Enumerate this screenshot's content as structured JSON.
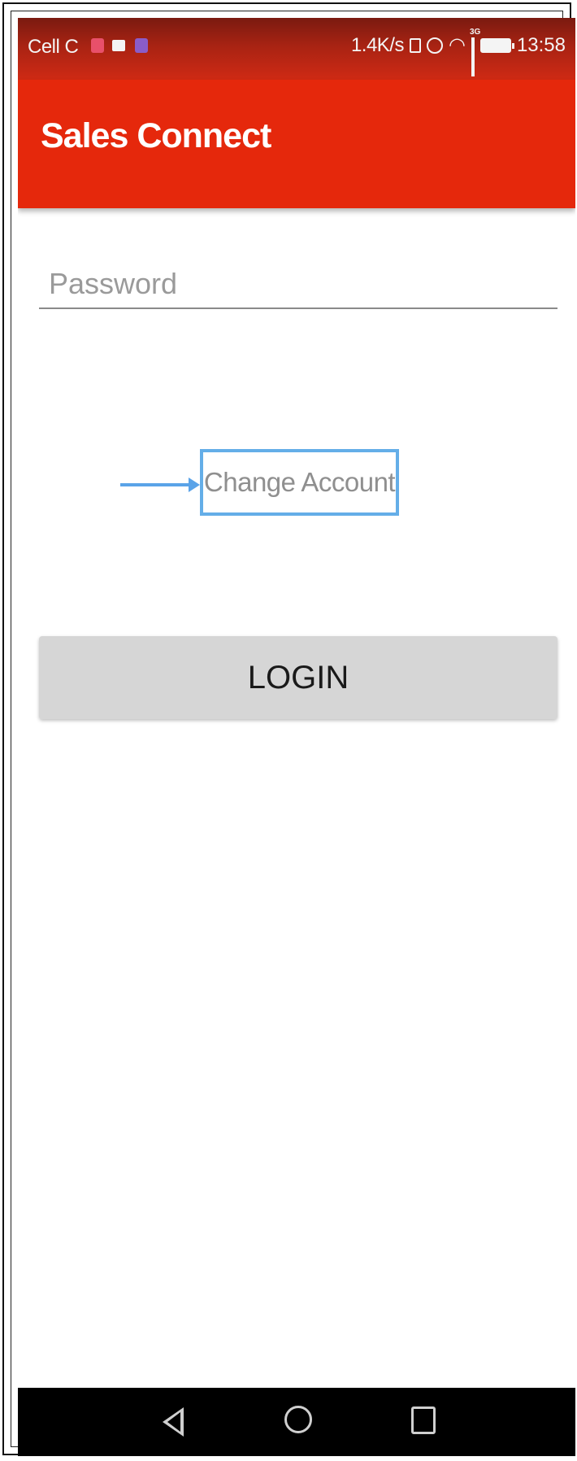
{
  "status_bar": {
    "carrier": "Cell C",
    "speed": "1.4K/s",
    "network_type": "3G",
    "time": "13:58",
    "notification_icons": [
      "notification-icon",
      "mail-icon",
      "app-icon"
    ]
  },
  "app_bar": {
    "title": "Sales Connect",
    "color": "#e5280c"
  },
  "form": {
    "password_placeholder": "Password",
    "password_value": "",
    "change_account_label": "Change Account",
    "login_label": "LOGIN"
  },
  "annotation": {
    "highlight_color": "#64aee8"
  },
  "nav_bar": {
    "icons": [
      "back-icon",
      "home-icon",
      "recents-icon"
    ]
  }
}
